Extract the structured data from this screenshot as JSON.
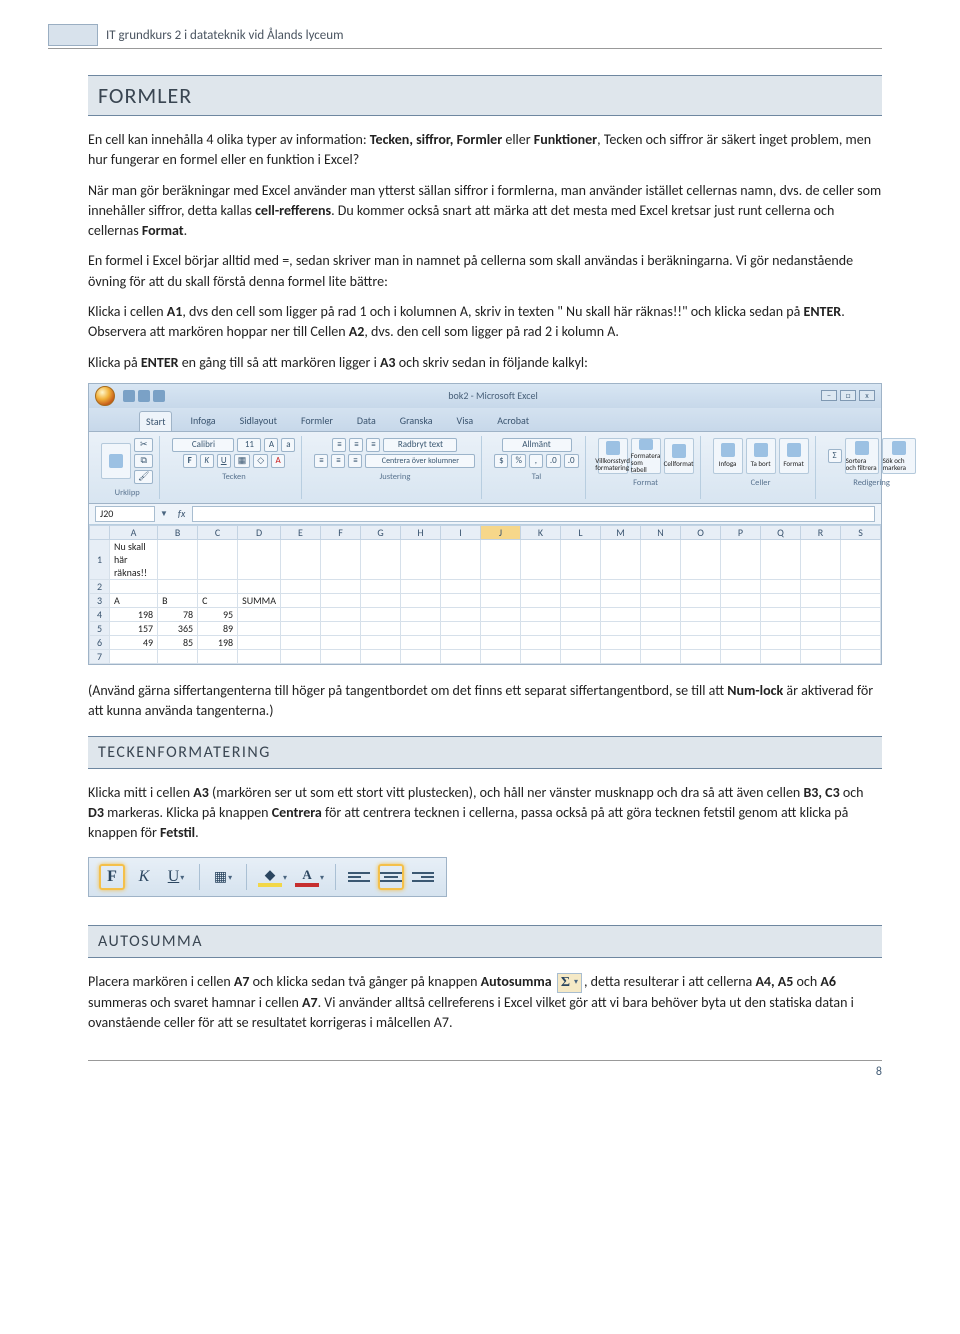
{
  "header": {
    "running_title": "IT grundkurs 2 i datateknik vid Ålands lyceum"
  },
  "h_formler": "FORMLER",
  "p1_a": "En cell kan innehålla 4 olika typer av information: ",
  "p1_b": "Tecken, siffror, Formler",
  "p1_c": " eller ",
  "p1_d": "Funktioner",
  "p1_e": ", Tecken och siffror är säkert inget problem, men hur fungerar en formel eller en funktion i Excel?",
  "p2_a": "När man gör beräkningar med Excel använder man ytterst sällan siffror i formlerna, man använder istället cellernas namn, dvs. de celler som innehåller siffror, detta kallas ",
  "p2_b": "cell-refferens",
  "p2_c": ". Du kommer också snart att märka att det mesta med Excel kretsar just runt cellerna och cellernas ",
  "p2_d": "Format",
  "p2_e": ".",
  "p3": "En formel i Excel börjar alltid med =, sedan skriver man in namnet på cellerna som skall användas i beräkningarna. Vi gör nedanstående övning för att du skall förstå denna formel lite bättre:",
  "p4_a": "Klicka i cellen ",
  "p4_b": "A1",
  "p4_c": ", dvs den cell som ligger på rad 1 och i kolumnen A, skriv in texten \" Nu skall här räknas!!\" och klicka sedan på ",
  "p4_d": "ENTER",
  "p4_e": ". Observera att markören hoppar ner till Cellen ",
  "p4_f": "A2",
  "p4_g": ", dvs. den cell som ligger på rad 2 i kolumn A.",
  "p5_a": "Klicka på ",
  "p5_b": "ENTER",
  "p5_c": " en gång till så att markören ligger i ",
  "p5_d": "A3",
  "p5_e": " och skriv sedan in följande kalkyl:",
  "excel": {
    "title": "bok2 - Microsoft Excel",
    "tabs": [
      "Start",
      "Infoga",
      "Sidlayout",
      "Formler",
      "Data",
      "Granska",
      "Visa",
      "Acrobat"
    ],
    "active_tab": "Start",
    "font_name": "Calibri",
    "font_size": "11",
    "wrap": "Radbryt text",
    "merge": "Centrera över kolumner",
    "numfmt": "Allmänt",
    "groups": {
      "clipboard": "Urklipp",
      "font": "Tecken",
      "align": "Justering",
      "number": "Tal",
      "styles": "Format",
      "cells": "Celler",
      "editing": "Redigering"
    },
    "style_btns": {
      "cond": "Villkorsstyrd formatering",
      "table": "Formatera som tabell",
      "cell": "Cellformat"
    },
    "cell_btns": {
      "insert": "Infoga",
      "delete": "Ta bort",
      "format": "Format"
    },
    "edit_btns": {
      "sort": "Sortera och filtrera",
      "find": "Sök och markera"
    },
    "namebox": "J20",
    "cols": [
      "A",
      "B",
      "C",
      "D",
      "E",
      "F",
      "G",
      "H",
      "I",
      "J",
      "K",
      "L",
      "M",
      "N",
      "O",
      "P",
      "Q",
      "R",
      "S"
    ],
    "rows": [
      {
        "n": "1",
        "cells": [
          "Nu skall här räknas!!"
        ]
      },
      {
        "n": "2",
        "cells": []
      },
      {
        "n": "3",
        "cells": [
          "A",
          "B",
          "C",
          "SUMMA"
        ]
      },
      {
        "n": "4",
        "cells": [
          "198",
          "78",
          "95"
        ]
      },
      {
        "n": "5",
        "cells": [
          "157",
          "365",
          "89"
        ]
      },
      {
        "n": "6",
        "cells": [
          "49",
          "85",
          "198"
        ]
      },
      {
        "n": "7",
        "cells": []
      }
    ]
  },
  "p6_a": "(Använd gärna siffertangenterna till höger på tangentbordet om det finns ett separat siffertangentbord, se till att ",
  "p6_b": "Num-lock",
  "p6_c": " är aktiverad för att kunna använda tangenterna.)",
  "h_tecken": "TECKENFORMATERING",
  "p7_a": "Klicka mitt i cellen ",
  "p7_b": "A3",
  "p7_c": " (markören ser ut som ett stort vitt plustecken), och håll ner vänster musknapp och dra så att även cellen ",
  "p7_d": "B3, C3",
  "p7_e": " och ",
  "p7_f": "D3",
  "p7_g": " markeras. Klicka på knappen ",
  "p7_h": "Centrera",
  "p7_i": " för att centrera tecknen i cellerna, passa också på att göra tecknen fetstil genom att klicka på knappen för ",
  "p7_j": "Fetstil",
  "p7_k": ".",
  "fmt": {
    "bold": "F",
    "italic": "K",
    "underline": "U"
  },
  "h_autosum": "AUTOSUMMA",
  "p8_a": "Placera markören i cellen ",
  "p8_b": "A7",
  "p8_c": " och klicka sedan två gånger på knappen ",
  "p8_d": "Autosumma",
  "p8_e": ", detta resulterar i att cellerna ",
  "p8_f": "A4, A5",
  "p8_g": " och ",
  "p8_h": "A6",
  "p8_i": " summeras och svaret hamnar i cellen ",
  "p8_j": "A7",
  "p8_k": ". Vi använder alltså cellreferens i Excel vilket gör att vi bara behöver byta ut den statiska datan i ovanstående celler för att se resultatet korrigeras i målcellen A7.",
  "page_no": "8"
}
